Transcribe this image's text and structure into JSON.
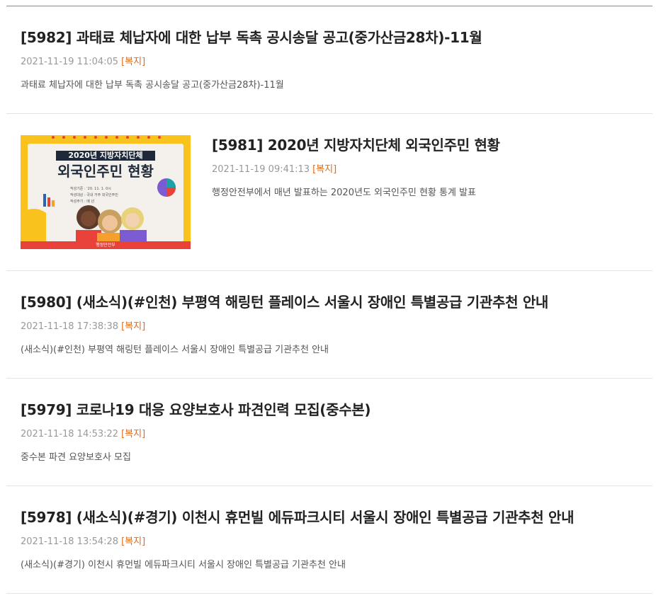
{
  "posts": [
    {
      "title": "[5982] 과태료 체납자에 대한 납부 독촉 공시송달 공고(중가산금28차)-11월",
      "date": "2021-11-19 11:04:05",
      "category": "[복지]",
      "summary": "과태료 체납자에 대한 납부 독촉 공시송달 공고(중가산금28차)-11월"
    },
    {
      "title": "[5981] 2020년 지방자치단체 외국인주민 현황",
      "date": "2021-11-19 09:41:13",
      "category": "[복지]",
      "summary": "행정안전부에서 매년 발표하는 2020년도 외국인주민 현황 통계 발표",
      "thumbnail": {
        "heading_small": "2020년 지방자치단체",
        "heading_big": "외국인주민 현황",
        "info_lines": [
          "작성기준 : '20. 11. 1. 0시",
          "작성대상 : 국내 거주 외국인주민",
          "작성주기 : 매 년"
        ],
        "footer": "행정안전부"
      }
    },
    {
      "title": "[5980] (새소식)(#인천) 부평역 해링턴 플레이스 서울시 장애인 특별공급 기관추천 안내",
      "date": "2021-11-18 17:38:38",
      "category": "[복지]",
      "summary": "(새소식)(#인천) 부평역 해링턴 플레이스 서울시 장애인 특별공급 기관추천 안내"
    },
    {
      "title": "[5979] 코로나19 대응 요양보호사 파견인력 모집(중수본)",
      "date": "2021-11-18 14:53:22",
      "category": "[복지]",
      "summary": "중수본 파견 요양보호사 모집"
    },
    {
      "title": "[5978] (새소식)(#경기) 이천시 휴먼빌 에듀파크시티 서울시 장애인 특별공급 기관추천 안내",
      "date": "2021-11-18 13:54:28",
      "category": "[복지]",
      "summary": "(새소식)(#경기) 이천시 휴먼빌 에듀파크시티 서울시 장애인 특별공급 기관추천 안내"
    }
  ],
  "colors": {
    "category": "#e06a1b",
    "thumb_bg": "#f9c21c",
    "thumb_accent": "#e8413a"
  }
}
